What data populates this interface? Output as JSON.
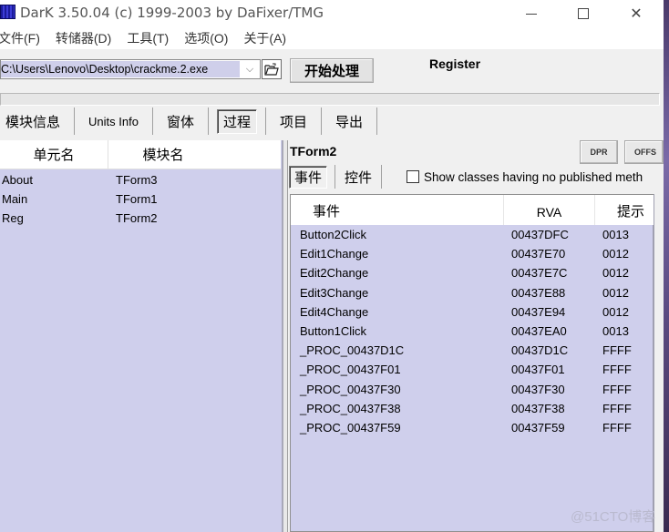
{
  "window": {
    "title": "DarK 3.50.04 (c) 1999-2003 by DaFixer/TMG",
    "controls": {
      "minimize": "minimize",
      "maximize": "maximize",
      "close": "close"
    }
  },
  "menu": {
    "items": [
      {
        "label": "文件(F)"
      },
      {
        "label": "转储器(D)"
      },
      {
        "label": "工具(T)"
      },
      {
        "label": "选项(O)"
      },
      {
        "label": "关于(A)"
      }
    ]
  },
  "toolbar": {
    "file_path": "C:\\Users\\Lenovo\\Desktop\\crackme.2.exe",
    "open_icon": "folder-open-icon",
    "process_button": "开始处理",
    "register_label": "Register"
  },
  "progress": {
    "value_percent": 0
  },
  "tabs": [
    {
      "label": "模块信息",
      "active": false
    },
    {
      "label": "Units Info",
      "active": false
    },
    {
      "label": "窗体",
      "active": false
    },
    {
      "label": "过程",
      "active": true
    },
    {
      "label": "项目",
      "active": false
    },
    {
      "label": "导出",
      "active": false
    }
  ],
  "units": {
    "headers": [
      "单元名",
      "模块名"
    ],
    "rows": [
      {
        "unit": "About",
        "module": "TForm3"
      },
      {
        "unit": "Main",
        "module": "TForm1"
      },
      {
        "unit": "Reg",
        "module": "TForm2"
      }
    ]
  },
  "detail": {
    "form_title": "TForm2",
    "dpr_button": "DPR",
    "offs_button": "OFFS",
    "subtabs": [
      {
        "label": "事件",
        "active": true
      },
      {
        "label": "控件",
        "active": false
      }
    ],
    "show_classes_checkbox": {
      "label": "Show classes having no published meth",
      "checked": false
    },
    "events": {
      "headers": [
        "事件",
        "RVA",
        "提示"
      ],
      "rows": [
        {
          "name": "Button2Click",
          "rva": "00437DFC",
          "hint": "0013"
        },
        {
          "name": "Edit1Change",
          "rva": "00437E70",
          "hint": "0012"
        },
        {
          "name": "Edit2Change",
          "rva": "00437E7C",
          "hint": "0012"
        },
        {
          "name": "Edit3Change",
          "rva": "00437E88",
          "hint": "0012"
        },
        {
          "name": "Edit4Change",
          "rva": "00437E94",
          "hint": "0012"
        },
        {
          "name": "Button1Click",
          "rva": "00437EA0",
          "hint": "0013"
        },
        {
          "name": "_PROC_00437D1C",
          "rva": "00437D1C",
          "hint": "FFFF"
        },
        {
          "name": "_PROC_00437F01",
          "rva": "00437F01",
          "hint": "FFFF"
        },
        {
          "name": "_PROC_00437F30",
          "rva": "00437F30",
          "hint": "FFFF"
        },
        {
          "name": "_PROC_00437F38",
          "rva": "00437F38",
          "hint": "FFFF"
        },
        {
          "name": "_PROC_00437F59",
          "rva": "00437F59",
          "hint": "FFFF"
        }
      ]
    }
  },
  "watermark": "@51CTO博客",
  "colors": {
    "list_background": "#cfcfec",
    "window_background": "#f0f0f0"
  }
}
